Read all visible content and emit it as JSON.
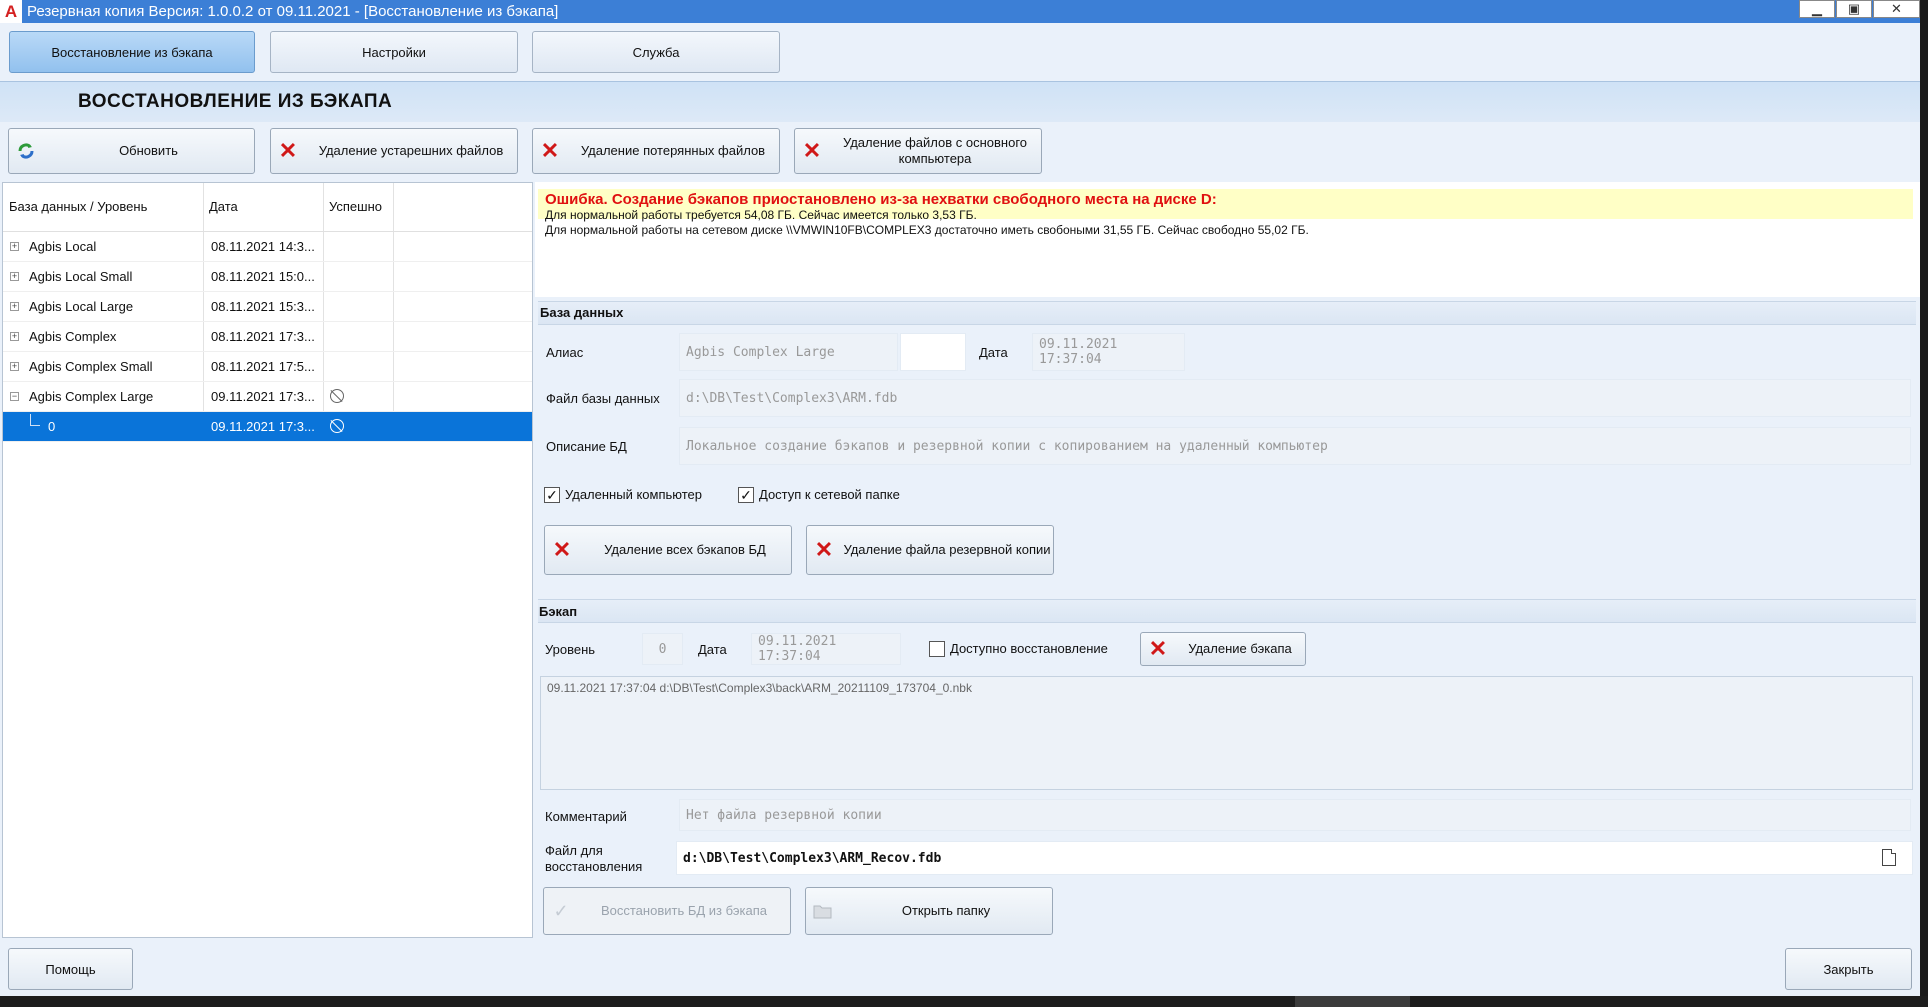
{
  "window": {
    "title": "Резервная копия   Версия: 1.0.0.2 от 09.11.2021 - [Восстановление из бэкапа]",
    "icon_letter": "A",
    "controls": [
      "▁",
      "▣",
      "✕"
    ]
  },
  "tabs": [
    {
      "label": "Восстановление из бэкапа",
      "active": true
    },
    {
      "label": "Настройки",
      "active": false
    },
    {
      "label": "Служба",
      "active": false
    }
  ],
  "section_title": "ВОССТАНОВЛЕНИЕ ИЗ БЭКАПА",
  "toolbar": {
    "refresh": "Обновить",
    "delete_old": "Удаление устарешних файлов",
    "delete_lost": "Удаление потерянных файлов",
    "delete_main_line1": "Удаление файлов с основного",
    "delete_main_line2": "компьютера"
  },
  "tree": {
    "columns": [
      "База данных / Уровень",
      "Дата",
      "Успешно"
    ],
    "rows": [
      {
        "name": "Agbis Local",
        "date": "08.11.2021 14:3...",
        "expander": "+",
        "status": false
      },
      {
        "name": "Agbis Local Small",
        "date": "08.11.2021 15:0...",
        "expander": "+",
        "status": false
      },
      {
        "name": "Agbis Local Large",
        "date": "08.11.2021 15:3...",
        "expander": "+",
        "status": false
      },
      {
        "name": "Agbis Complex",
        "date": "08.11.2021 17:3...",
        "expander": "+",
        "status": false
      },
      {
        "name": "Agbis Complex Small",
        "date": "08.11.2021 17:5...",
        "expander": "+",
        "status": false
      },
      {
        "name": "Agbis Complex Large",
        "date": "09.11.2021 17:3...",
        "expander": "−",
        "status": true
      },
      {
        "name": "0",
        "date": "09.11.2021 17:3...",
        "expander": "",
        "status": true,
        "selected": true,
        "child": true
      }
    ]
  },
  "error": {
    "headline": "Ошибка. Создание бэкапов приостановлено из-за нехватки свободного места на диске D:",
    "line1": "Для нормальной работы требуется 54,08 ГБ. Сейчас имеется только 3,53 ГБ.",
    "line2": "Для нормальной работы на сетевом диске \\\\VMWIN10FB\\COMPLEX3 достаточно иметь свобоными 31,55 ГБ. Сейчас свободно 55,02 ГБ."
  },
  "database": {
    "group_title": "База данных",
    "alias_label": "Алиас",
    "alias_value": "Agbis Complex Large",
    "date_label": "Дата",
    "date_value": "09.11.2021 17:37:04",
    "file_label": "Файл базы данных",
    "file_value": "d:\\DB\\Test\\Complex3\\ARM.fdb",
    "desc_label": "Описание БД",
    "desc_value": "Локальное создание бэкапов и резервной копии с копированием на удаленный компьютер",
    "remote_label": "Удаленный компьютер",
    "remote_checked": true,
    "netfolder_label": "Доступ к сетевой папке",
    "netfolder_checked": true,
    "delete_all_btn": "Удаление всех бэкапов БД",
    "delete_file_btn": "Удаление файла резервной копии"
  },
  "backup": {
    "group_title": "Бэкап",
    "level_label": "Уровень",
    "level_value": "0",
    "date_label": "Дата",
    "date_value": "09.11.2021 17:37:04",
    "restore_available_label": "Доступно восстановление",
    "restore_available_checked": false,
    "delete_backup_btn": "Удаление бэкапа",
    "log_text": "09.11.2021 17:37:04 d:\\DB\\Test\\Complex3\\back\\ARM_20211109_173704_0.nbk",
    "comment_label": "Комментарий",
    "comment_value": "Нет файла резервной копии",
    "restore_file_label_1": "Файл для",
    "restore_file_label_2": "восстановления",
    "restore_file_value": "d:\\DB\\Test\\Complex3\\ARM_Recov.fdb",
    "restore_btn": "Восстановить БД из бэкапа",
    "open_folder_btn": "Открыть папку"
  },
  "footer": {
    "help": "Помощь",
    "close": "Закрыть"
  }
}
